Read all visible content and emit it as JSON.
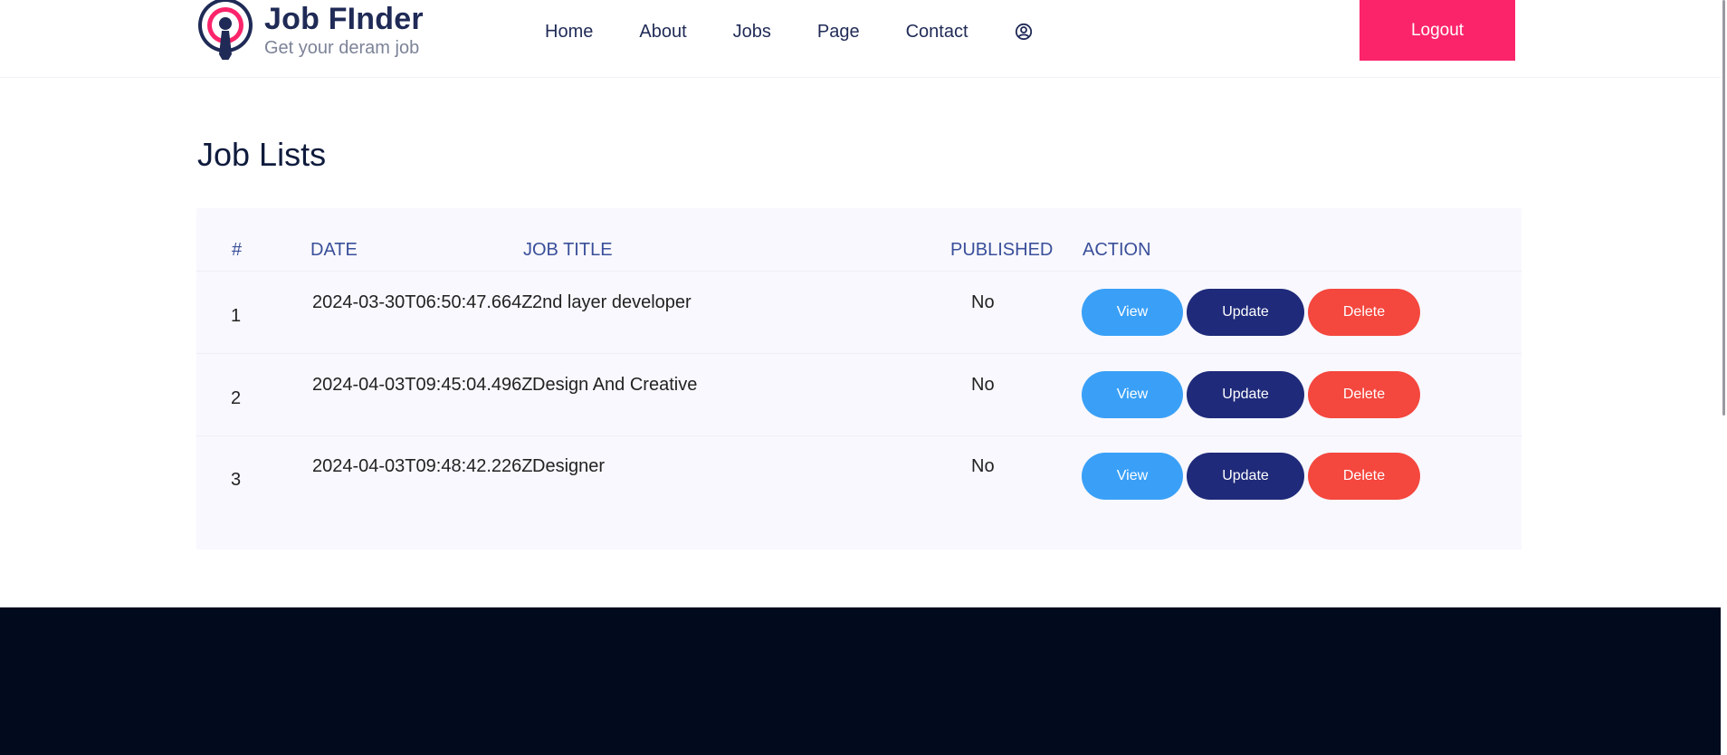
{
  "header": {
    "logo_name": "Job FInder",
    "logo_tagline": "Get your deram job",
    "nav": [
      "Home",
      "About",
      "Jobs",
      "Page",
      "Contact"
    ],
    "user_icon": "user-circle-icon",
    "logout_label": "Logout"
  },
  "main": {
    "title": "Job Lists",
    "table": {
      "headers": [
        "#",
        "DATE",
        "JOB TITLE",
        "PUBLISHED",
        "ACTION"
      ],
      "rows": [
        {
          "num": "1",
          "date": "2024-03-30T06:50:47.664Z",
          "title": "2nd layer developer",
          "published": "No"
        },
        {
          "num": "2",
          "date": "2024-04-03T09:45:04.496Z",
          "title": "Design And Creative",
          "published": "No"
        },
        {
          "num": "3",
          "date": "2024-04-03T09:48:42.226Z",
          "title": "Designer",
          "published": "No"
        }
      ],
      "actions": {
        "view": "View",
        "update": "Update",
        "delete": "Delete"
      }
    }
  },
  "colors": {
    "brand_navy": "#1f2a56",
    "accent_pink": "#fb246a",
    "view_blue": "#3aa0f7",
    "update_navy": "#1f2a7a",
    "delete_red": "#f4473e",
    "footer_bg": "#010b1d"
  }
}
